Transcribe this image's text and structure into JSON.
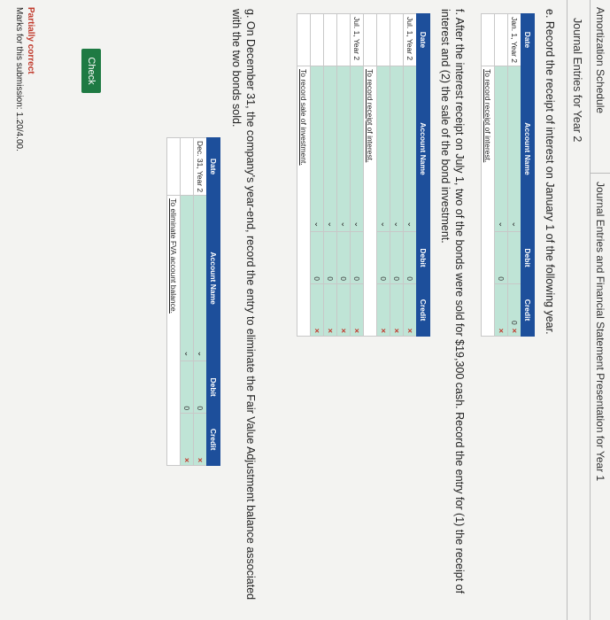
{
  "tabs": [
    "Amortization Schedule",
    "Journal Entries and Financial Statement Presentation for Year 1"
  ],
  "subtab": "Journal Entries for Year 2",
  "section_e": {
    "instruction": "e. Record the receipt of interest on January 1 of the following year.",
    "headers": [
      "Date",
      "Account Name",
      "Debit",
      "Credit"
    ],
    "rows": [
      {
        "date": "Jan. 1, Year 2",
        "debit": "",
        "credit": "0",
        "credit_mark": "×"
      },
      {
        "date": "",
        "debit": "0",
        "credit": "",
        "credit_mark": "×"
      }
    ],
    "note": "To record receipt of interest."
  },
  "section_f": {
    "instruction": "f. After the interest receipt on July 1, two of the bonds were sold for $19,300 cash. Record the entry for (1) the receipt of interest and (2) the sale of the bond investment.",
    "headers": [
      "Date",
      "Account Name",
      "Debit",
      "Credit"
    ],
    "group1": {
      "rows": [
        {
          "date": "Jul. 1, Year 2",
          "debit": "0",
          "credit": "",
          "credit_mark": "×"
        },
        {
          "date": "",
          "debit": "0",
          "credit": "",
          "credit_mark": "×"
        },
        {
          "date": "",
          "debit": "0",
          "credit": "",
          "credit_mark": "×"
        }
      ],
      "note": "To record receipt of interest."
    },
    "group2": {
      "rows": [
        {
          "date": "Jul. 1, Year 2",
          "debit": "0",
          "credit": "",
          "credit_mark": "×"
        },
        {
          "date": "",
          "debit": "0",
          "credit": "",
          "credit_mark": "×"
        },
        {
          "date": "",
          "debit": "0",
          "credit": "",
          "credit_mark": "×"
        },
        {
          "date": "",
          "debit": "0",
          "credit": "",
          "credit_mark": "×"
        }
      ],
      "note": "To record sale of investment."
    }
  },
  "section_g": {
    "instruction": "g. On December 31, the company's year-end, record the entry to eliminate the Fair Value Adjustment balance associated with the two bonds sold.",
    "headers": [
      "Date",
      "Account Name",
      "Debit",
      "Credit"
    ],
    "rows": [
      {
        "date": "Dec. 31, Year 2",
        "debit": "0",
        "credit": "",
        "credit_mark": "×"
      },
      {
        "date": "",
        "debit": "0",
        "credit": "",
        "credit_mark": "×"
      }
    ],
    "note": "To eliminate FVA account balance."
  },
  "check_label": "Check",
  "status": {
    "label": "Partially correct",
    "marks": "Marks for this submission: 1.20/4.00."
  }
}
